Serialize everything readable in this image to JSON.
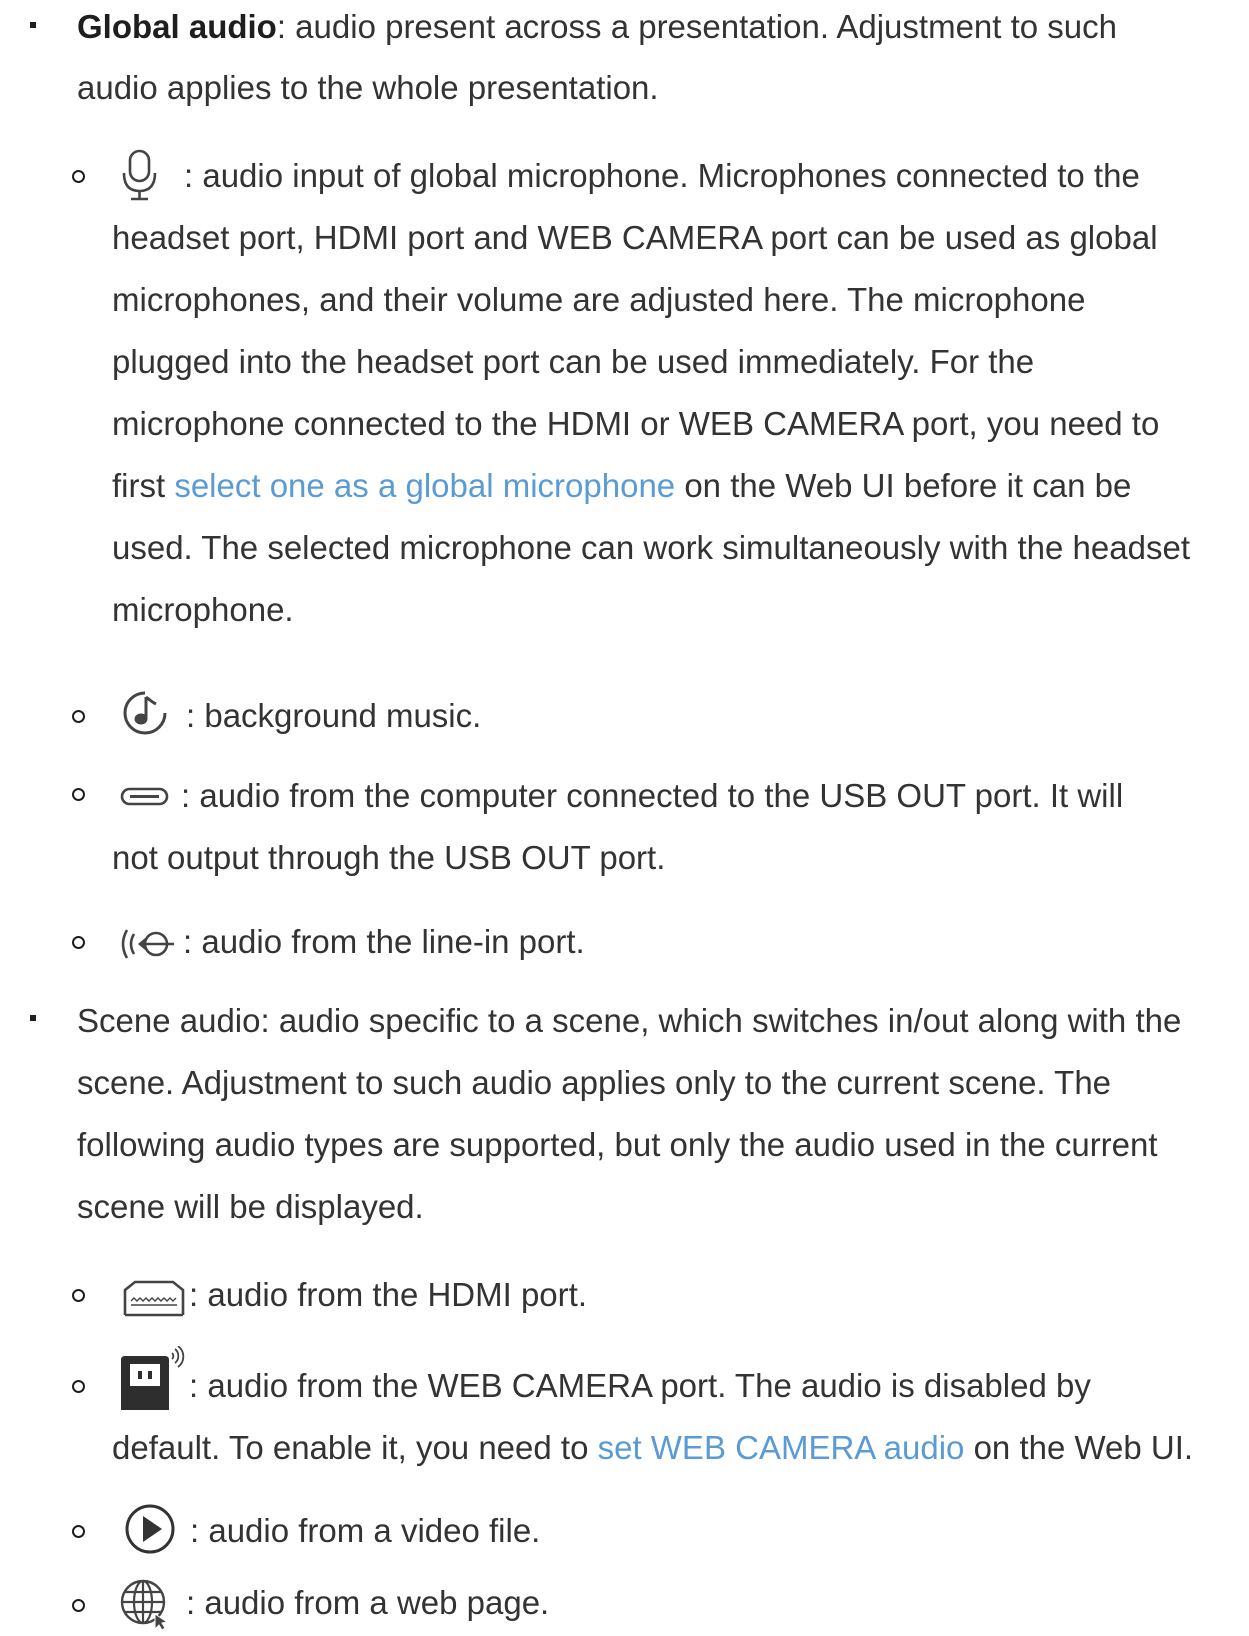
{
  "global_audio": {
    "term": "Global audio",
    "intro_line1": ": audio present across a presentation. Adjustment to such",
    "intro_line2": "audio applies to the whole presentation.",
    "items": [
      {
        "icon": "microphone-icon",
        "lines": [
          ": audio input of global microphone. Microphones connected to the",
          "headset port, HDMI port and WEB CAMERA port can be used as global",
          "microphones, and their volume are adjusted here. The microphone",
          "plugged into the headset port can be used immediately. For the",
          "microphone connected to the HDMI or WEB CAMERA port, you need to"
        ],
        "line6_before": "first ",
        "line6_link": "select one as a global microphone",
        "line6_after": " on the Web UI before it can be",
        "line7": "used. The selected microphone can work simultaneously with the headset",
        "line8": "microphone."
      },
      {
        "icon": "music-note-icon",
        "lines": [
          ": background music."
        ]
      },
      {
        "icon": "usb-port-icon",
        "lines": [
          ": audio from the computer connected to the USB OUT port. It will",
          "not output through the USB OUT port."
        ]
      },
      {
        "icon": "line-in-icon",
        "lines": [
          ": audio from the line-in port."
        ]
      }
    ]
  },
  "scene_audio": {
    "lines": [
      "Scene audio: audio specific to a scene, which switches in/out along with the",
      "scene. Adjustment to such audio applies only to the current scene. The",
      "following audio types are supported, but only the audio used in the current",
      "scene will be displayed."
    ],
    "items": [
      {
        "icon": "hdmi-port-icon",
        "lines": [
          ": audio from the HDMI port."
        ]
      },
      {
        "icon": "web-camera-icon",
        "line1": ": audio from the WEB CAMERA port. The audio is disabled by",
        "line2_before": "default. To enable it, you need to ",
        "line2_link": "set WEB CAMERA audio",
        "line2_after": " on the Web UI."
      },
      {
        "icon": "play-icon",
        "lines": [
          ": audio from a video file."
        ]
      },
      {
        "icon": "globe-icon",
        "lines": [
          ": audio from a web page."
        ]
      }
    ]
  }
}
